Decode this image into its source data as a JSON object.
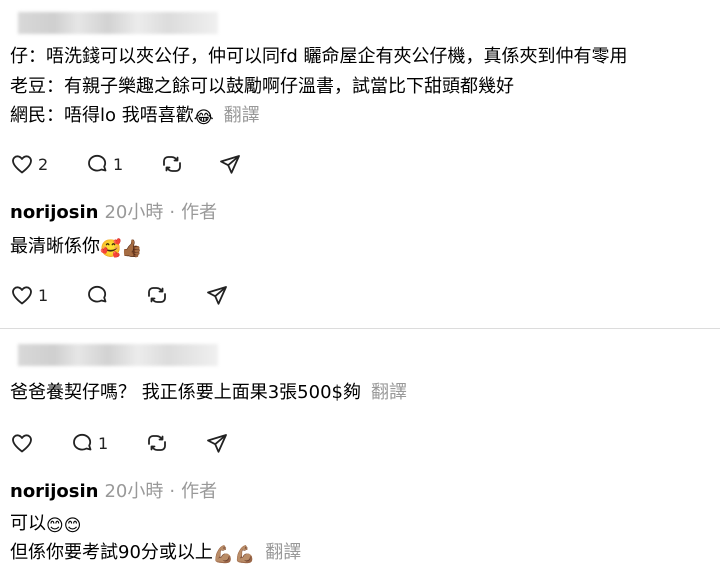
{
  "post1": {
    "lines": [
      "仔：唔洗錢可以夾公仔，仲可以同fd 矖命屋企有夾公仔機，真係夾到仲有零用",
      "老豆：有親子樂趣之餘可以鼓勵啊仔溫書，試當比下甜頭都幾好",
      "網民：唔得lo 我唔喜歡"
    ],
    "line3_emoji": "😂",
    "translate": "翻譯",
    "like_count": "2",
    "reply_count": "1"
  },
  "reply1": {
    "username": "norijosin",
    "time": "20小時",
    "separator": "·",
    "author_tag": "作者",
    "text": "最清晰係你",
    "emoji1": "🥰",
    "emoji2": "👍🏾",
    "like_count": "1"
  },
  "post2": {
    "text": "爸爸養契仔嗎？ 我正係要上面果3張500$夠",
    "translate": "翻譯",
    "reply_count": "1"
  },
  "reply2": {
    "username": "norijosin",
    "time": "20小時",
    "separator": "·",
    "author_tag": "作者",
    "line1": "可以",
    "line1_emoji": "😊😊",
    "line2": "但係你要考試90分或以上",
    "line2_emoji": "💪🏽💪🏽",
    "translate": "翻譯"
  }
}
